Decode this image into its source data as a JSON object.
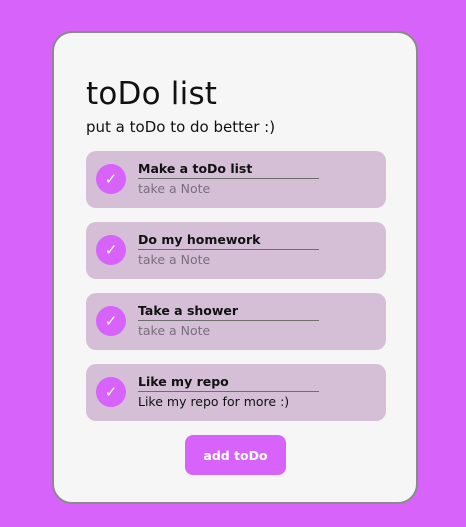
{
  "header": {
    "title": "toDo list",
    "subtitle": "put a toDo to do better :)"
  },
  "todos": [
    {
      "title": "Make a toDo list",
      "note": "",
      "note_placeholder": "take a Note",
      "checked": true,
      "check_icon": "checkmark-icon"
    },
    {
      "title": "Do my homework",
      "note": "",
      "note_placeholder": "take a Note",
      "checked": true,
      "check_icon": "checkmark-icon"
    },
    {
      "title": "Take a shower",
      "note": "",
      "note_placeholder": "take a Note",
      "checked": true,
      "check_icon": "checkmark-icon"
    },
    {
      "title": "Like my repo",
      "note": "Like my repo for more :)",
      "note_placeholder": "take a Note",
      "checked": true,
      "check_icon": "checkmark-icon"
    }
  ],
  "add_button_label": "add toDo",
  "colors": {
    "background": "#d863fb",
    "card": "#f6f6f6",
    "item": "#d4bfd7",
    "accent": "#d863fb"
  }
}
